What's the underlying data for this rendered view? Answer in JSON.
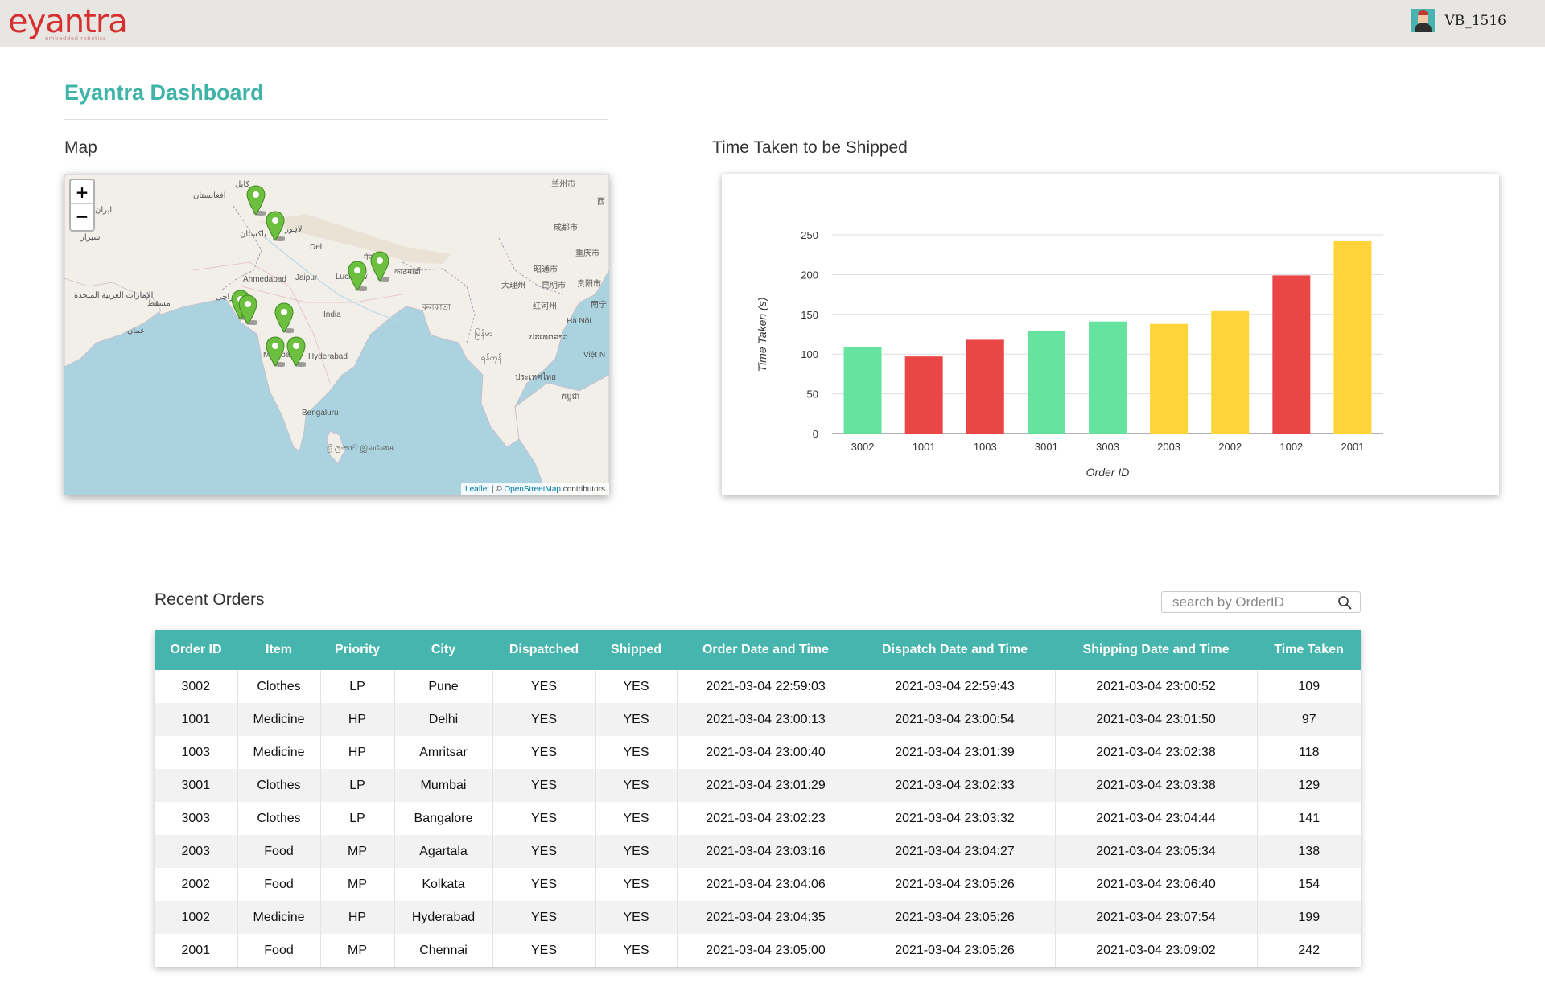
{
  "header": {
    "logo_text": "eyantra",
    "logo_subtext": "embedded robotics",
    "username": "VB_1516"
  },
  "page": {
    "title": "Eyantra Dashboard",
    "map_label": "Map",
    "chart_label": "Time Taken to be Shipped",
    "orders_label": "Recent Orders"
  },
  "map": {
    "zoom_in": "+",
    "zoom_out": "−",
    "attribution_leaflet": "Leaflet",
    "attribution_sep": " | © ",
    "attribution_osm": "OpenStreetMap",
    "attribution_suffix": " contributors",
    "places": {
      "jaipur": "Jaipur",
      "lucknow": "Lucknow",
      "ahmedabad": "Ahmedabad",
      "india": "India",
      "mumbai": "Mumbai",
      "hyderabad": "Hyderabad",
      "bengaluru": "Bengaluru",
      "pakistan": "پاکستان",
      "nepal": "नेपाल",
      "kathmandu": "काठमाडौं",
      "kabul": "کابل",
      "afghanistan": "افغانستان",
      "lahore": "لاہور",
      "muscat": "مسقط",
      "karachi": "کراچی",
      "oman": "عمان",
      "uae": "الإمارات العربية المتحدة",
      "iran": "ایران",
      "shiraz": "شیراز",
      "lanzhou": "兰州市",
      "chengdu": "成都市",
      "chongqing": "重庆市",
      "zhaotong": "昭通市",
      "dali": "大理州",
      "kunming": "昆明市",
      "guiyang": "贵阳市",
      "honghe": "红河州",
      "nanning": "南宁",
      "hanoi": "Hà Nội",
      "myanmar": "မြန်မာ",
      "laos": "ປະເທດລາວ",
      "yangon": "ရန်ကုန်",
      "vietnam": "Việt N",
      "thailand": "ประเทศไทย",
      "cambodia": "កម្ពុជា",
      "srilanka": "ශ්‍රී ලංකාව\nஇலங்கை",
      "west": "西",
      "delhi": "Del",
      "kolkata": "কলকাতা"
    }
  },
  "chart_data": {
    "type": "bar",
    "title": "",
    "xlabel": "Order ID",
    "ylabel": "Time Taken (s)",
    "categories": [
      "3002",
      "1001",
      "1003",
      "3001",
      "3003",
      "2003",
      "2002",
      "1002",
      "2001"
    ],
    "values": [
      109,
      97,
      118,
      129,
      141,
      138,
      154,
      199,
      242
    ],
    "bar_colors": [
      "#66e39f",
      "#ea4646",
      "#ea4646",
      "#66e39f",
      "#66e39f",
      "#ffd43b",
      "#ffd43b",
      "#ea4646",
      "#ffd43b"
    ],
    "ylim": [
      0,
      250
    ],
    "yticks": [
      0,
      50,
      100,
      150,
      200,
      250
    ],
    "grid": true,
    "legend": "none"
  },
  "orders": {
    "search_placeholder": "search by OrderID",
    "columns": [
      "Order ID",
      "Item",
      "Priority",
      "City",
      "Dispatched",
      "Shipped",
      "Order Date and Time",
      "Dispatch Date and Time",
      "Shipping Date and Time",
      "Time Taken"
    ],
    "rows": [
      [
        "3002",
        "Clothes",
        "LP",
        "Pune",
        "YES",
        "YES",
        "2021-03-04 22:59:03",
        "2021-03-04 22:59:43",
        "2021-03-04 23:00:52",
        "109"
      ],
      [
        "1001",
        "Medicine",
        "HP",
        "Delhi",
        "YES",
        "YES",
        "2021-03-04 23:00:13",
        "2021-03-04 23:00:54",
        "2021-03-04 23:01:50",
        "97"
      ],
      [
        "1003",
        "Medicine",
        "HP",
        "Amritsar",
        "YES",
        "YES",
        "2021-03-04 23:00:40",
        "2021-03-04 23:01:39",
        "2021-03-04 23:02:38",
        "118"
      ],
      [
        "3001",
        "Clothes",
        "LP",
        "Mumbai",
        "YES",
        "YES",
        "2021-03-04 23:01:29",
        "2021-03-04 23:02:33",
        "2021-03-04 23:03:38",
        "129"
      ],
      [
        "3003",
        "Clothes",
        "LP",
        "Bangalore",
        "YES",
        "YES",
        "2021-03-04 23:02:23",
        "2021-03-04 23:03:32",
        "2021-03-04 23:04:44",
        "141"
      ],
      [
        "2003",
        "Food",
        "MP",
        "Agartala",
        "YES",
        "YES",
        "2021-03-04 23:03:16",
        "2021-03-04 23:04:27",
        "2021-03-04 23:05:34",
        "138"
      ],
      [
        "2002",
        "Food",
        "MP",
        "Kolkata",
        "YES",
        "YES",
        "2021-03-04 23:04:06",
        "2021-03-04 23:05:26",
        "2021-03-04 23:06:40",
        "154"
      ],
      [
        "1002",
        "Medicine",
        "HP",
        "Hyderabad",
        "YES",
        "YES",
        "2021-03-04 23:04:35",
        "2021-03-04 23:05:26",
        "2021-03-04 23:07:54",
        "199"
      ],
      [
        "2001",
        "Food",
        "MP",
        "Chennai",
        "YES",
        "YES",
        "2021-03-04 23:05:00",
        "2021-03-04 23:05:26",
        "2021-03-04 23:09:02",
        "242"
      ]
    ]
  }
}
